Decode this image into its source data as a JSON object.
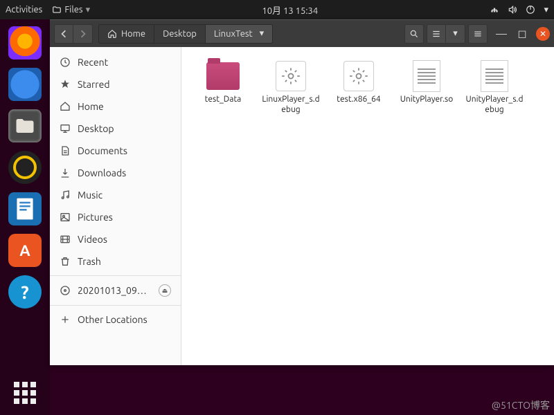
{
  "top_panel": {
    "activities": "Activities",
    "app_menu": "Files",
    "clock": "10月 13  15:34"
  },
  "nautilus": {
    "path": {
      "home": "Home",
      "seg2": "Desktop",
      "seg3": "LinuxTest"
    },
    "sidebar": {
      "recent": "Recent",
      "starred": "Starred",
      "home": "Home",
      "desktop": "Desktop",
      "documents": "Documents",
      "downloads": "Downloads",
      "music": "Music",
      "pictures": "Pictures",
      "videos": "Videos",
      "trash": "Trash",
      "disk": "20201013_09…",
      "other": "Other Locations"
    },
    "files": [
      {
        "name": "test_Data",
        "type": "folder"
      },
      {
        "name": "LinuxPlayer_s.debug",
        "type": "exec"
      },
      {
        "name": "test.x86_64",
        "type": "exec"
      },
      {
        "name": "UnityPlayer.so",
        "type": "text"
      },
      {
        "name": "UnityPlayer_s.debug",
        "type": "text"
      }
    ]
  },
  "watermark": "@51CTO博客"
}
